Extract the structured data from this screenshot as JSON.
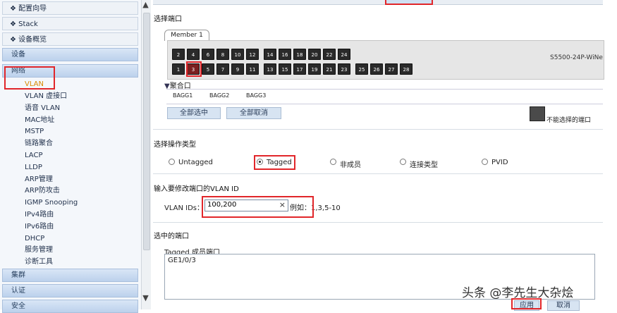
{
  "sidebar": {
    "top_items": [
      "配置向导",
      "Stack",
      "设备概览"
    ],
    "sections": {
      "device": "设备",
      "network": "网络",
      "cluster": "集群",
      "auth": "认证",
      "security": "安全"
    },
    "items": [
      "VLAN",
      "VLAN 虚接口",
      "语音 VLAN",
      "MAC地址",
      "MSTP",
      "链路聚合",
      "LACP",
      "LLDP",
      "ARP管理",
      "ARP防攻击",
      "IGMP Snooping",
      "IPv4路由",
      "IPv6路由",
      "DHCP",
      "服务管理",
      "诊断工具"
    ],
    "active_item": "VLAN"
  },
  "scroll": {
    "up": "▲",
    "down": "▼"
  },
  "port_section": {
    "title": "选择端口",
    "member_tab": "Member 1",
    "device_model": "S5500-24P-WiNe",
    "top_ports": [
      "2",
      "4",
      "6",
      "8",
      "10",
      "12",
      "14",
      "16",
      "18",
      "20",
      "22",
      "24"
    ],
    "bottom_ports": [
      "1",
      "3",
      "5",
      "7",
      "9",
      "11",
      "13",
      "15",
      "17",
      "19",
      "21",
      "23"
    ],
    "extra_ports": [
      "25",
      "26",
      "27",
      "28"
    ],
    "selected_port": "3",
    "agg_title": "聚合口",
    "agg_ports": [
      "BAGG1",
      "BAGG2",
      "BAGG3"
    ],
    "select_all": "全部选中",
    "deselect_all": "全部取消",
    "legend_unselectable": "不能选择的端口"
  },
  "op_section": {
    "title": "选择操作类型",
    "options": [
      "Untagged",
      "Tagged",
      "非成员",
      "连接类型",
      "PVID"
    ],
    "selected": "Tagged"
  },
  "vlan_section": {
    "title": "输入要修改端口的VLAN ID",
    "label": "VLAN IDs：",
    "value": "100,200",
    "clear": "×",
    "example": "例如：1,3,5-10"
  },
  "selected_ports": {
    "title": "选中的端口",
    "subtitle": "Tagged 成员端口",
    "list": "GE1/0/3"
  },
  "actions": {
    "apply": "应用",
    "cancel": "取消"
  },
  "watermark": "头条 @李先生大杂烩",
  "colors": {
    "highlight": "#e1262a",
    "active_item": "#d88a00"
  }
}
